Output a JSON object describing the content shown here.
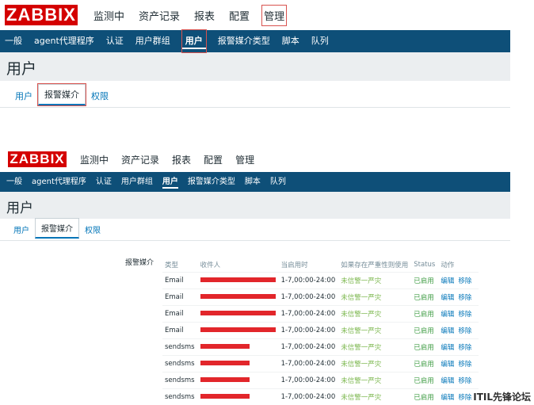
{
  "logo": "ZABBIX",
  "top_menu": [
    "监测中",
    "资产记录",
    "报表",
    "配置",
    "管理"
  ],
  "sub_nav": [
    "一般",
    "agent代理程序",
    "认证",
    "用户群组",
    "用户",
    "报警媒介类型",
    "脚本",
    "队列"
  ],
  "page_title": "用户",
  "tabs": [
    "用户",
    "报警媒介",
    "权限"
  ],
  "media": {
    "label": "报警媒介",
    "headers": [
      "类型",
      "收件人",
      "当启用时",
      "如果存在严重性则使用",
      "Status",
      "动作"
    ],
    "rows": [
      {
        "type": "Email",
        "period": "1-7,00:00-24:00",
        "severity": "未信警一严灾",
        "status": "已启用"
      },
      {
        "type": "Email",
        "period": "1-7,00:00-24:00",
        "severity": "未信警一严灾",
        "status": "已启用"
      },
      {
        "type": "Email",
        "period": "1-7,00:00-24:00",
        "severity": "未信警一严灾",
        "status": "已启用"
      },
      {
        "type": "Email",
        "period": "1-7,00:00-24:00",
        "severity": "未信警一严灾",
        "status": "已启用"
      },
      {
        "type": "sendsms",
        "period": "1-7,00:00-24:00",
        "severity": "未信警一严灾",
        "status": "已启用"
      },
      {
        "type": "sendsms",
        "period": "1-7,00:00-24:00",
        "severity": "未信警一严灾",
        "status": "已启用"
      },
      {
        "type": "sendsms",
        "period": "1-7,00:00-24:00",
        "severity": "未信警一严灾",
        "status": "已启用"
      },
      {
        "type": "sendsms",
        "period": "1-7,00:00-24:00",
        "severity": "未信警一严灾",
        "status": "已启用"
      }
    ],
    "edit_label": "编辑",
    "remove_label": "移除"
  },
  "watermark": "ITIL先锋论坛"
}
